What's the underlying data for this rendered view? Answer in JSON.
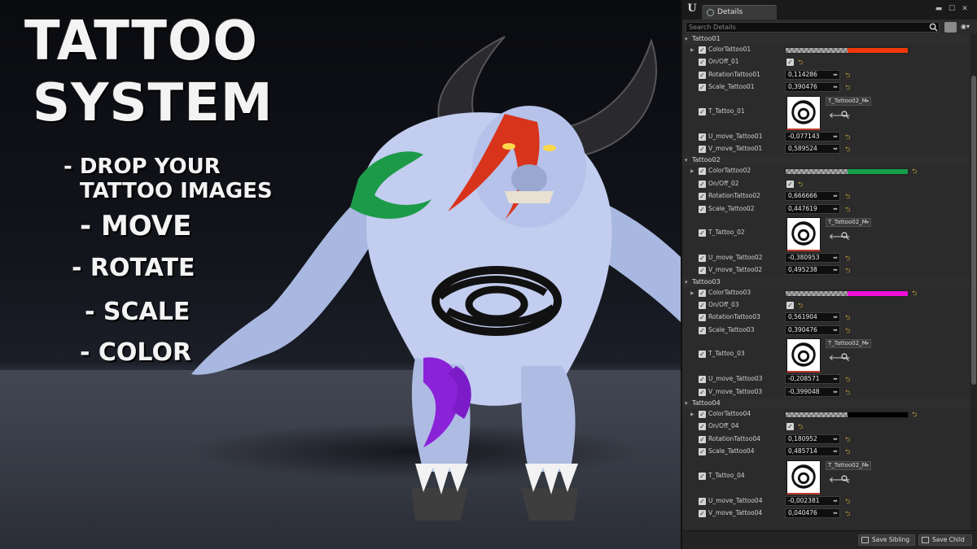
{
  "promo": {
    "title_line1": "TATTOO",
    "title_line2": "SYSTEM",
    "feature_drop_1": "- DROP YOUR",
    "feature_drop_2": "TATTOO IMAGES",
    "feature_move": "- MOVE",
    "feature_rotate": "- ROTATE",
    "feature_scale": "- SCALE",
    "feature_color": "- COLOR"
  },
  "panel": {
    "tab_label": "Details",
    "search_placeholder": "Search Details",
    "save_sibling": "Save Sibling",
    "save_child": "Save Child",
    "scroll_position": 0.22
  },
  "groups": [
    {
      "name": "Tattoo01",
      "color_label": "ColorTattoo01",
      "color_hex": "#f0380a",
      "onoff_label": "On/Off_01",
      "rotation_label": "RotationTattoo01",
      "rotation_value": "0,114286",
      "scale_label": "Scale_Tattoo01",
      "scale_value": "0,390476",
      "texture_label": "T_Tattoo_01",
      "texture_asset": "T_Tattoo02_M",
      "u_label": "U_move_Tattoo01",
      "u_value": "-0,077143",
      "v_label": "V_move_Tattoo01",
      "v_value": "0,589524"
    },
    {
      "name": "Tattoo02",
      "color_label": "ColorTattoo02",
      "color_hex": "#14a04a",
      "onoff_label": "On/Off_02",
      "rotation_label": "RotationTattoo02",
      "rotation_value": "0,666666",
      "scale_label": "Scale_Tattoo02",
      "scale_value": "0,447619",
      "texture_label": "T_Tattoo_02",
      "texture_asset": "T_Tattoo02_M",
      "u_label": "U_move_Tattoo02",
      "u_value": "-0,380953",
      "v_label": "V_move_Tattoo02",
      "v_value": "0,495238"
    },
    {
      "name": "Tattoo03",
      "color_label": "ColorTattoo03",
      "color_hex": "#f010d8",
      "onoff_label": "On/Off_03",
      "rotation_label": "RotationTattoo03",
      "rotation_value": "0,561904",
      "scale_label": "Scale_Tattoo03",
      "scale_value": "0,390476",
      "texture_label": "T_Tattoo_03",
      "texture_asset": "T_Tattoo02_M",
      "u_label": "U_move_Tattoo03",
      "u_value": "-0,208571",
      "v_label": "V_move_Tattoo03",
      "v_value": "-0,399048"
    },
    {
      "name": "Tattoo04",
      "color_label": "ColorTattoo04",
      "color_hex": "#000000",
      "onoff_label": "On/Off_04",
      "rotation_label": "RotationTattoo04",
      "rotation_value": "0,180952",
      "scale_label": "Scale_Tattoo04",
      "scale_value": "0,485714",
      "texture_label": "T_Tattoo_04",
      "texture_asset": "T_Tattoo02_M",
      "u_label": "U_move_Tattoo04",
      "u_value": "-0,002381",
      "v_label": "V_move_Tattoo04",
      "v_value": "0,040476"
    }
  ],
  "colors": {
    "panel_bg": "#2b2b2b",
    "reset_arrow": "#c9a53a",
    "texture_underline": "#c0392b"
  }
}
